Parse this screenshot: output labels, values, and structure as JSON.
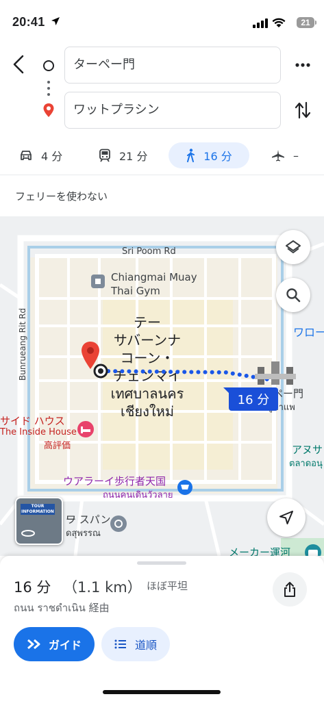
{
  "status": {
    "time": "20:41",
    "battery": "21"
  },
  "directions": {
    "origin": "ターペー門",
    "destination": "ワットプラシン"
  },
  "modes": [
    {
      "icon": "car-icon",
      "label": "4 分"
    },
    {
      "icon": "transit-icon",
      "label": "21 分"
    },
    {
      "icon": "walk-icon",
      "label": "16 分",
      "selected": true
    },
    {
      "icon": "flight-icon",
      "label": "–"
    }
  ],
  "options": {
    "ferry": "フェリーを使わない"
  },
  "map": {
    "street_sri_poom": "Sri Poom Rd",
    "street_bunrueang": "Bunrueang Rit Rd",
    "poi_gym_line1": "Chiangmai Muay",
    "poi_gym_line2": "Thai Gym",
    "destination_label_lines": [
      "テー",
      "サバーンナ",
      "コーン・",
      "チェンマイ",
      "เทศบาลนคร",
      "เชียงใหม่"
    ],
    "route_badge": "16 分",
    "origin_label": "ペー門",
    "origin_label_thai": "ูท่าแพ",
    "wat_label": "ワロー",
    "inside_house_1": "サイド ハウス",
    "inside_house_2": "The Inside House",
    "inside_house_3": "高評価",
    "walking_street_1": "ウアラーイ歩行者天国",
    "walking_street_2": "ถนนคนเดินวัวลาย",
    "wat_phan_1": "ワ",
    "wat_phan_2": "ー スパン",
    "wat_phan_3": "ดสุพรรณ",
    "anusarn_1": "アヌサ",
    "anusarn_2": "ตลาดอนุ",
    "canal": "メーカー運河",
    "thumb_text": "TOUR INFORMATION"
  },
  "route": {
    "duration": "16 分",
    "distance": "（1.1 km）",
    "terrain": "ほぼ平坦",
    "via": "ถนน ราชดำเนิน 経由",
    "guide_label": "ガイド",
    "steps_label": "道順"
  },
  "colors": {
    "accent": "#1a73e8",
    "route_dot": "#1a57e8",
    "badge": "#1a4fd8",
    "pin": "#ea4335"
  }
}
